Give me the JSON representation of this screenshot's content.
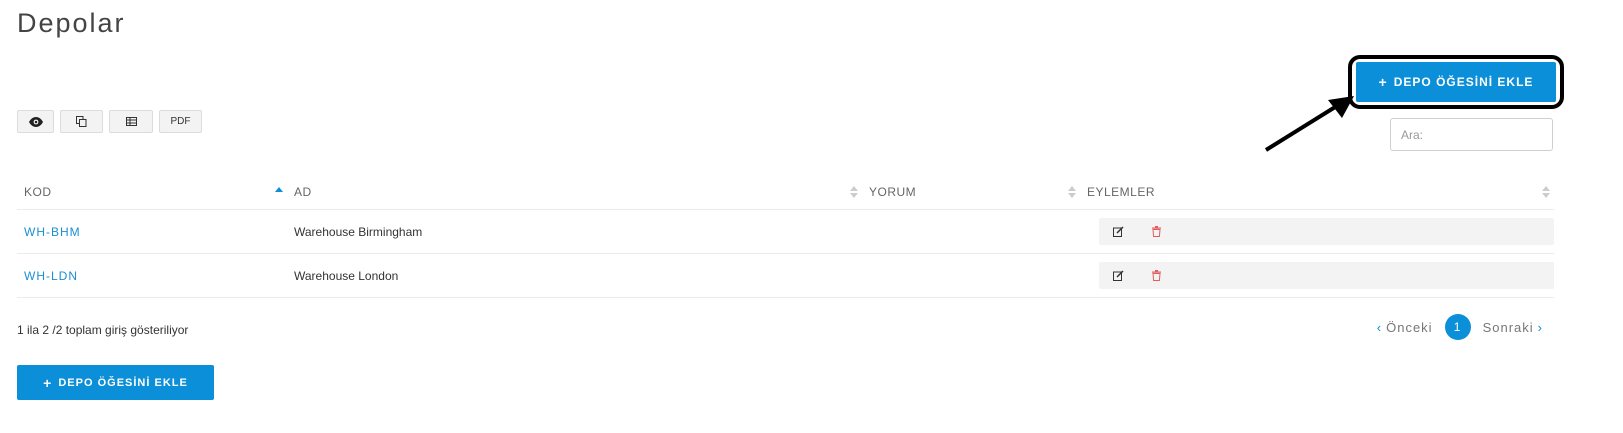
{
  "page": {
    "title": "Depolar"
  },
  "toolbar": {
    "buttons": [
      {
        "icon": "eye-icon"
      },
      {
        "icon": "copy-icon"
      },
      {
        "icon": "table-icon"
      },
      {
        "label": "PDF"
      }
    ]
  },
  "add_button": {
    "label": "DEPO ÖĞESİNİ EKLE"
  },
  "search": {
    "placeholder": "Ara:"
  },
  "table": {
    "columns": [
      "KOD",
      "AD",
      "YORUM",
      "EYLEMLER"
    ],
    "rows": [
      {
        "code": "WH-BHM",
        "name": "Warehouse Birmingham",
        "comment": ""
      },
      {
        "code": "WH-LDN",
        "name": "Warehouse London",
        "comment": ""
      }
    ]
  },
  "info": {
    "text": "1 ila 2 /2 toplam giriş gösteriliyor"
  },
  "pagination": {
    "prev": "Önceki",
    "current": "1",
    "next": "Sonraki"
  },
  "colors": {
    "accent": "#0b8fd8",
    "link": "#1a8fd2",
    "delete": "#e35d5d"
  }
}
